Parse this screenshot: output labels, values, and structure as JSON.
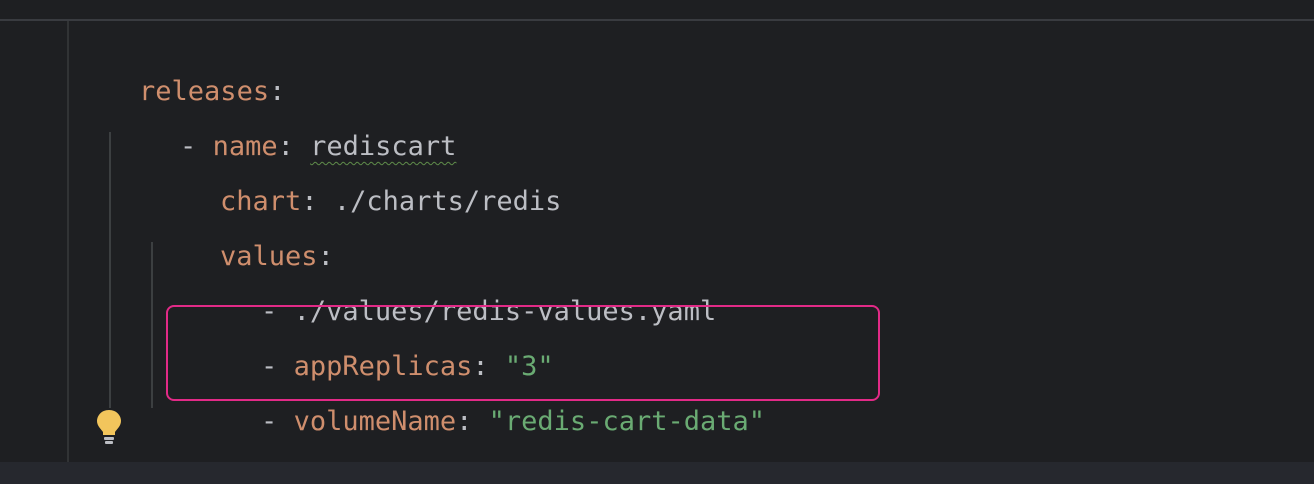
{
  "editor": {
    "lines": [
      {
        "key": "releases",
        "colon": ":"
      },
      {
        "dash": "-",
        "key": "name",
        "colon": ":",
        "value": "rediscart"
      },
      {
        "key": "chart",
        "colon": ":",
        "value": "./charts/redis"
      },
      {
        "key": "values",
        "colon": ":"
      },
      {
        "dash": "-",
        "value": "./values/redis-values.yaml"
      },
      {
        "dash": "-",
        "key": "appReplicas",
        "colon": ":",
        "value": "\"3\""
      },
      {
        "dash": "-",
        "key": "volumeName",
        "colon": ":",
        "value": "\"redis-cart-data\""
      }
    ],
    "intention_icon": "lightbulb-icon"
  },
  "colors": {
    "background": "#1e1f22",
    "key": "#cf8e6d",
    "string": "#6aab73",
    "plain": "#bcbec4",
    "highlight": "#e22a87",
    "bulb": "#f2c55c"
  }
}
